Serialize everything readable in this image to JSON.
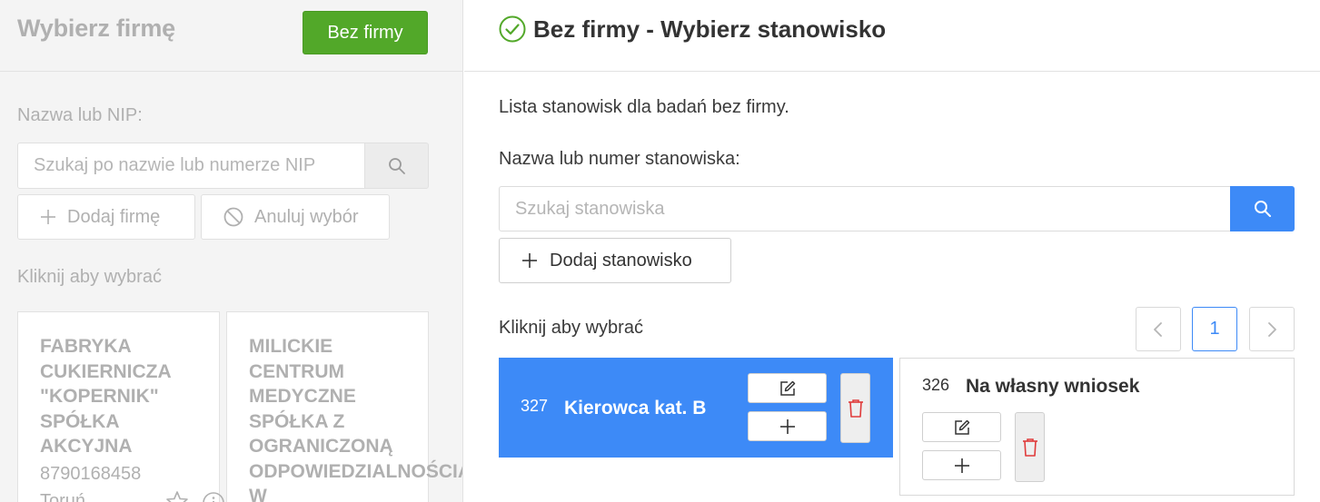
{
  "left_panel": {
    "title": "Wybierz firmę",
    "no_company_button": "Bez firmy",
    "search_label": "Nazwa lub NIP:",
    "search_placeholder": "Szukaj po nazwie lub numerze NIP",
    "add_company_button": "Dodaj firmę",
    "cancel_selection_button": "Anuluj wybór",
    "click_to_select": "Kliknij aby wybrać",
    "companies": [
      {
        "name": "FABRYKA CUKIERNICZA \"KOPERNIK\" SPÓŁKA AKCYJNA",
        "nip": "8790168458",
        "city": "Toruń"
      },
      {
        "name": "MILICKIE CENTRUM MEDYCZNE SPÓŁKA Z OGRANICZONĄ ODPOWIEDZIALNOŚCIĄ W"
      }
    ]
  },
  "right_panel": {
    "title": "Bez firmy - Wybierz stanowisko",
    "description": "Lista stanowisk dla badań bez firmy.",
    "search_label": "Nazwa lub numer stanowiska:",
    "search_placeholder": "Szukaj stanowiska",
    "add_position_button": "Dodaj stanowisko",
    "click_to_select": "Kliknij aby wybrać",
    "pagination": {
      "current_page": "1"
    },
    "positions": [
      {
        "number": "327",
        "name": "Kierowca kat. B",
        "selected": true
      },
      {
        "number": "326",
        "name": "Na własny wniosek",
        "selected": false
      }
    ]
  },
  "colors": {
    "green": "#52a829",
    "blue": "#3d8af7",
    "danger": "#e03a3a",
    "muted": "#b0b0b0"
  }
}
